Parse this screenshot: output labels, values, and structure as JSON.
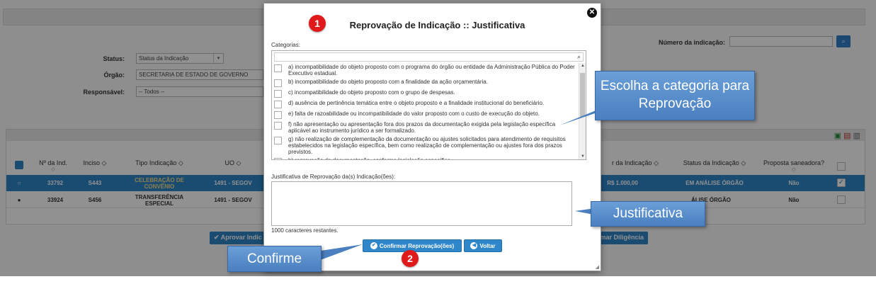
{
  "background": {
    "filters": {
      "status_label": "Status:",
      "status_value": "Status da Indicação",
      "orgao_label": "Órgão:",
      "orgao_value": "SECRETARIA DE ESTADO DE GOVERNO",
      "responsavel_label": "Responsável:",
      "responsavel_value": "-- Todos --",
      "numero_label": "Número da indicação:",
      "numero_value": ""
    },
    "table": {
      "headers": [
        {
          "label": "Nº da Ind.",
          "sort": "◇"
        },
        {
          "label": "Inciso",
          "sort": "◇"
        },
        {
          "label": "Tipo Indicação",
          "sort": "◇"
        },
        {
          "label": "UO",
          "sort": "◇"
        },
        {
          "label": "r da Indicação",
          "sort": "◇"
        },
        {
          "label": "Status da Indicação",
          "sort": "◇"
        },
        {
          "label": "Proposta saneadora?",
          "sort": "◇"
        }
      ],
      "rows": [
        {
          "numero": "33792",
          "inciso": "S443",
          "tipo": "CELEBRAÇÃO DE CONVÊNIO",
          "uo": "1491 - SEGOV",
          "valor": "R$ 1.000,00",
          "status": "EM ANÁLISE ÓRGÃO",
          "saneadora": "Não"
        },
        {
          "numero": "33924",
          "inciso": "S456",
          "tipo": "TRANSFERÊNCIA ESPECIAL",
          "uo": "1491 - SEGOV",
          "valor": "",
          "status": "ÁLISE ÓRGÃO",
          "saneadora": "Não"
        }
      ]
    },
    "buttons": {
      "aprovar": "Aprovar Indic",
      "diligencia": "rmar Diligência"
    }
  },
  "modal": {
    "title": "Reprovação de Indicação :: Justificativa",
    "categories_label": "Categorias:",
    "categories_search": "",
    "categories": [
      "a) incompatibilidade do objeto proposto com o programa do órgão ou entidade da Administração Pública do Poder Executivo estadual.",
      "b) incompatibilidade do objeto proposto com a finalidade da ação orçamentária.",
      "c) incompatibilidade do objeto proposto com o grupo de despesas.",
      "d) ausência de pertinência temática entre o objeto proposto e a finalidade institucional do beneficiário.",
      "e) falta de razoabilidade ou incompatibilidade do valor proposto com o custo de execução do objeto.",
      "f) não apresentação ou apresentação fora dos prazos da documentação exigida pela legislação específica aplicável ao instrumento jurídico a ser formalizado.",
      "g) não realização de complementação da documentação ou ajustes solicitados para atendimento de requisitos estabelecidos na legislação específica, bem como realização de complementação ou ajustes fora dos prazos previstos.",
      "h) reprovação da documentação, conforme legislação específica."
    ],
    "justificativa_label": "Justificativa de Reprovação da(s) Indicação(ões):",
    "justificativa_value": "",
    "chars_remaining": "1000 caracteres restantes.",
    "confirm_label": "Confirmar Reprovação(ões)",
    "back_label": "Voltar"
  },
  "annotations": {
    "step1": "1",
    "step2": "2",
    "callout_categoria": "Escolha a categoria para Reprovação",
    "callout_justificativa": "Justificativa",
    "callout_confirme": "Confirme",
    "callout_color": "#4a7fc0",
    "badge_color": "#e01a1a"
  },
  "colors": {
    "primary_button": "#2f86c9",
    "selected_row": "#2f86c9",
    "overlay": "rgba(0,0,0,0.43)"
  }
}
